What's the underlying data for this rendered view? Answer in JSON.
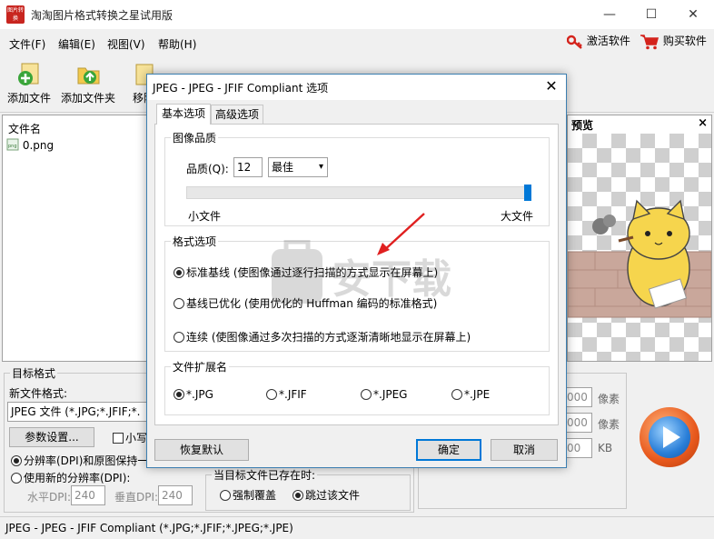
{
  "window": {
    "app_icon_text": "图片转换",
    "title": "淘淘图片格式转换之星试用版",
    "minimize": "—",
    "maximize": "☐",
    "close": "✕"
  },
  "menu": {
    "items": [
      "文件(F)",
      "编辑(E)",
      "视图(V)",
      "帮助(H)"
    ],
    "activate": "激活软件",
    "buy": "购买软件"
  },
  "toolbar": {
    "add_file": "添加文件",
    "add_folder": "添加文件夹",
    "remove": "移除"
  },
  "file_list": {
    "header": "文件名",
    "files": [
      {
        "name": "0.png",
        "icon": "png-file-icon"
      }
    ]
  },
  "preview": {
    "title": "预览",
    "close": "×"
  },
  "target_format": {
    "legend": "目标格式",
    "new_format_label": "新文件格式:",
    "format_value": "JPEG 文件 (*.JPG;*.JFIF;*.",
    "params_button": "参数设置...",
    "small_checkbox": "小写",
    "dpi_keep": "分辨率(DPI)和原图保持一",
    "dpi_new": "使用新的分辨率(DPI):",
    "h_dpi_label": "水平DPI:",
    "h_dpi_value": "240",
    "v_dpi_label": "垂直DPI:",
    "v_dpi_value": "240"
  },
  "exists": {
    "legend": "当目标文件已存在时:",
    "overwrite": "强制覆盖",
    "skip": "跳过该文件"
  },
  "size": {
    "w_value": "000",
    "w_unit": "像素",
    "h_value": "000",
    "h_unit": "像素",
    "kb_value": "00",
    "kb_unit": "KB"
  },
  "status": {
    "text": "JPEG - JPEG - JFIF Compliant (*.JPG;*.JFIF;*.JPEG;*.JPE)"
  },
  "dialog": {
    "title": "JPEG - JPEG - JFIF Compliant 选项",
    "close": "✕",
    "tabs": [
      "基本选项",
      "高级选项"
    ],
    "quality_group": "图像品质",
    "quality_label": "品质(Q):",
    "quality_value": "12",
    "quality_select": "最佳",
    "small_file": "小文件",
    "large_file": "大文件",
    "quality_slider_fraction": 1.0,
    "format_group": "格式选项",
    "opt_baseline": "标准基线 (使图像通过逐行扫描的方式显示在屏幕上)",
    "opt_optimized": "基线已优化 (使用优化的 Huffman 编码的标准格式)",
    "opt_progressive": "连续 (使图像通过多次扫描的方式逐渐清晰地显示在屏幕上)",
    "ext_group": "文件扩展名",
    "ext_options": [
      "*.JPG",
      "*.JFIF",
      "*.JPEG",
      "*.JPE"
    ],
    "ext_selected": "*.JPG",
    "restore_default": "恢复默认",
    "ok": "确定",
    "cancel": "取消"
  },
  "watermark_text": "安下载",
  "colors": {
    "accent": "#0078d7",
    "dialog_border": "#3c7fb1",
    "arrow": "#e02020",
    "icon_red": "#c8251f"
  }
}
